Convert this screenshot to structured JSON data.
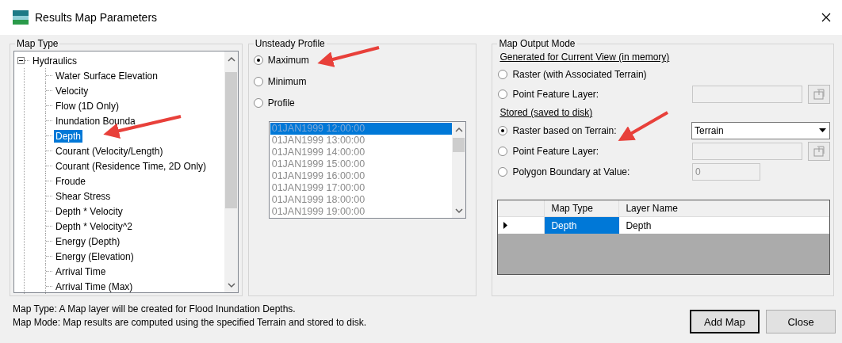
{
  "window": {
    "title": "Results Map Parameters"
  },
  "map_type": {
    "label": "Map Type",
    "tree": [
      {
        "label": "Hydraulics",
        "expanded": true,
        "selected": false,
        "children": [
          {
            "label": "Water Surface Elevation",
            "selected": false
          },
          {
            "label": "Velocity",
            "selected": false
          },
          {
            "label": "Flow (1D Only)",
            "selected": false
          },
          {
            "label": "Inundation Bounda",
            "selected": false
          },
          {
            "label": "Depth",
            "selected": true
          },
          {
            "label": "Courant (Velocity/Length)",
            "selected": false
          },
          {
            "label": "Courant (Residence Time, 2D Only)",
            "selected": false
          },
          {
            "label": "Froude",
            "selected": false
          },
          {
            "label": "Shear Stress",
            "selected": false
          },
          {
            "label": "Depth * Velocity",
            "selected": false
          },
          {
            "label": "Depth * Velocity^2",
            "selected": false
          },
          {
            "label": "Energy (Depth)",
            "selected": false
          },
          {
            "label": "Energy (Elevation)",
            "selected": false
          },
          {
            "label": "Arrival Time",
            "selected": false
          },
          {
            "label": "Arrival Time (Max)",
            "selected": false
          }
        ]
      }
    ]
  },
  "unsteady_profile": {
    "label": "Unsteady Profile",
    "options": [
      {
        "label": "Maximum",
        "selected": true
      },
      {
        "label": "Minimum",
        "selected": false
      },
      {
        "label": "Profile",
        "selected": false
      }
    ],
    "times_disabled": true,
    "times": [
      {
        "label": "01JAN1999 12:00:00",
        "selected": true
      },
      {
        "label": "01JAN1999 13:00:00",
        "selected": false
      },
      {
        "label": "01JAN1999 14:00:00",
        "selected": false
      },
      {
        "label": "01JAN1999 15:00:00",
        "selected": false
      },
      {
        "label": "01JAN1999 16:00:00",
        "selected": false
      },
      {
        "label": "01JAN1999 17:00:00",
        "selected": false
      },
      {
        "label": "01JAN1999 18:00:00",
        "selected": false
      },
      {
        "label": "01JAN1999 19:00:00",
        "selected": false
      }
    ]
  },
  "map_output_mode": {
    "label": "Map Output Mode",
    "sections": [
      {
        "heading": "Generated for Current View (in memory)",
        "options": [
          {
            "kind": "plain",
            "label": "Raster (with Associated Terrain)",
            "selected": false
          },
          {
            "kind": "layer",
            "label": "Point Feature Layer:",
            "selected": false
          }
        ]
      },
      {
        "heading": "Stored (saved to disk)",
        "options": [
          {
            "kind": "dropdown",
            "label": "Raster based on Terrain:",
            "selected": true,
            "value": "Terrain"
          },
          {
            "kind": "layer",
            "label": "Point Feature Layer:",
            "selected": false
          },
          {
            "kind": "value",
            "label": "Polygon Boundary at Value:",
            "selected": false,
            "value": "0"
          }
        ]
      }
    ],
    "table": {
      "columns": [
        "Map Type",
        "Layer Name"
      ],
      "rows": [
        {
          "selected": true,
          "cells": [
            {
              "text": "Depth",
              "selected": true
            },
            {
              "text": "Depth",
              "selected": false
            }
          ]
        }
      ]
    }
  },
  "status": [
    "Map Type: A Map layer will be created for Flood Inundation Depths.",
    "Map Mode: Map results are computed using the specified Terrain and stored to disk."
  ],
  "buttons": [
    {
      "label": "Add Map",
      "default": true
    },
    {
      "label": "Close",
      "default": false
    }
  ]
}
